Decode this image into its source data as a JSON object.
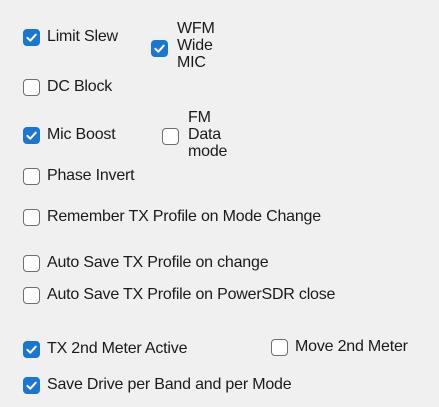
{
  "colors": {
    "background": "#f0f0f0",
    "checked_fill": "#1976d2",
    "unchecked_border": "#6e6e6e",
    "text": "#1a1a1a"
  },
  "check_icon": "checkmark-icon",
  "options": {
    "limit_slew": {
      "label": "Limit Slew",
      "checked": true
    },
    "wfm_wide_mic": {
      "label": "WFM\nWide\nMIC",
      "checked": true
    },
    "dc_block": {
      "label": "DC Block",
      "checked": false
    },
    "mic_boost": {
      "label": "Mic Boost",
      "checked": true
    },
    "fm_data_mode": {
      "label": "FM\nData\nmode",
      "checked": false
    },
    "phase_invert": {
      "label": "Phase Invert",
      "checked": false
    },
    "remember_tx_profile": {
      "label": "Remember TX Profile on Mode Change",
      "checked": false
    },
    "auto_save_on_change": {
      "label": "Auto Save TX Profile on change",
      "checked": false
    },
    "auto_save_on_close": {
      "label": "Auto Save TX Profile on PowerSDR close",
      "checked": false
    },
    "tx_2nd_meter_active": {
      "label": "TX 2nd Meter Active",
      "checked": true
    },
    "move_2nd_meter": {
      "label": "Move 2nd Meter",
      "checked": false
    },
    "save_drive_per_band": {
      "label": "Save Drive per Band and per Mode",
      "checked": true
    }
  }
}
